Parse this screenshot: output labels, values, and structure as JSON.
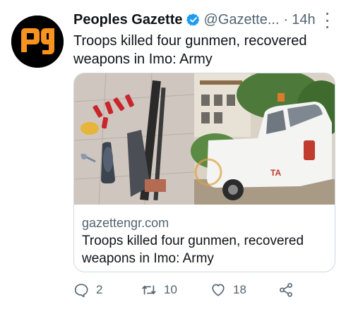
{
  "tweet": {
    "author_name": "Peoples Gazette",
    "author_handle": "@Gazette...",
    "separator": "·",
    "time": "14h",
    "text": "Troops killed four gunmen, recovered weapons in Imo: Army",
    "avatar_logo_text": "pg",
    "avatar_colors": {
      "background": "#000000",
      "logo": "#f7931e"
    },
    "verified_color": "#1d9bf0"
  },
  "card": {
    "image_icon": "news-photo-weapons-and-truck",
    "vehicle_marking": "TA",
    "domain": "gazettengr.com",
    "title": "Troops killed four gunmen, recovered weapons in Imo: Army"
  },
  "actions": {
    "reply_count": "2",
    "retweet_count": "10",
    "like_count": "18",
    "icons": [
      "reply-icon",
      "retweet-icon",
      "like-icon",
      "share-icon"
    ]
  }
}
